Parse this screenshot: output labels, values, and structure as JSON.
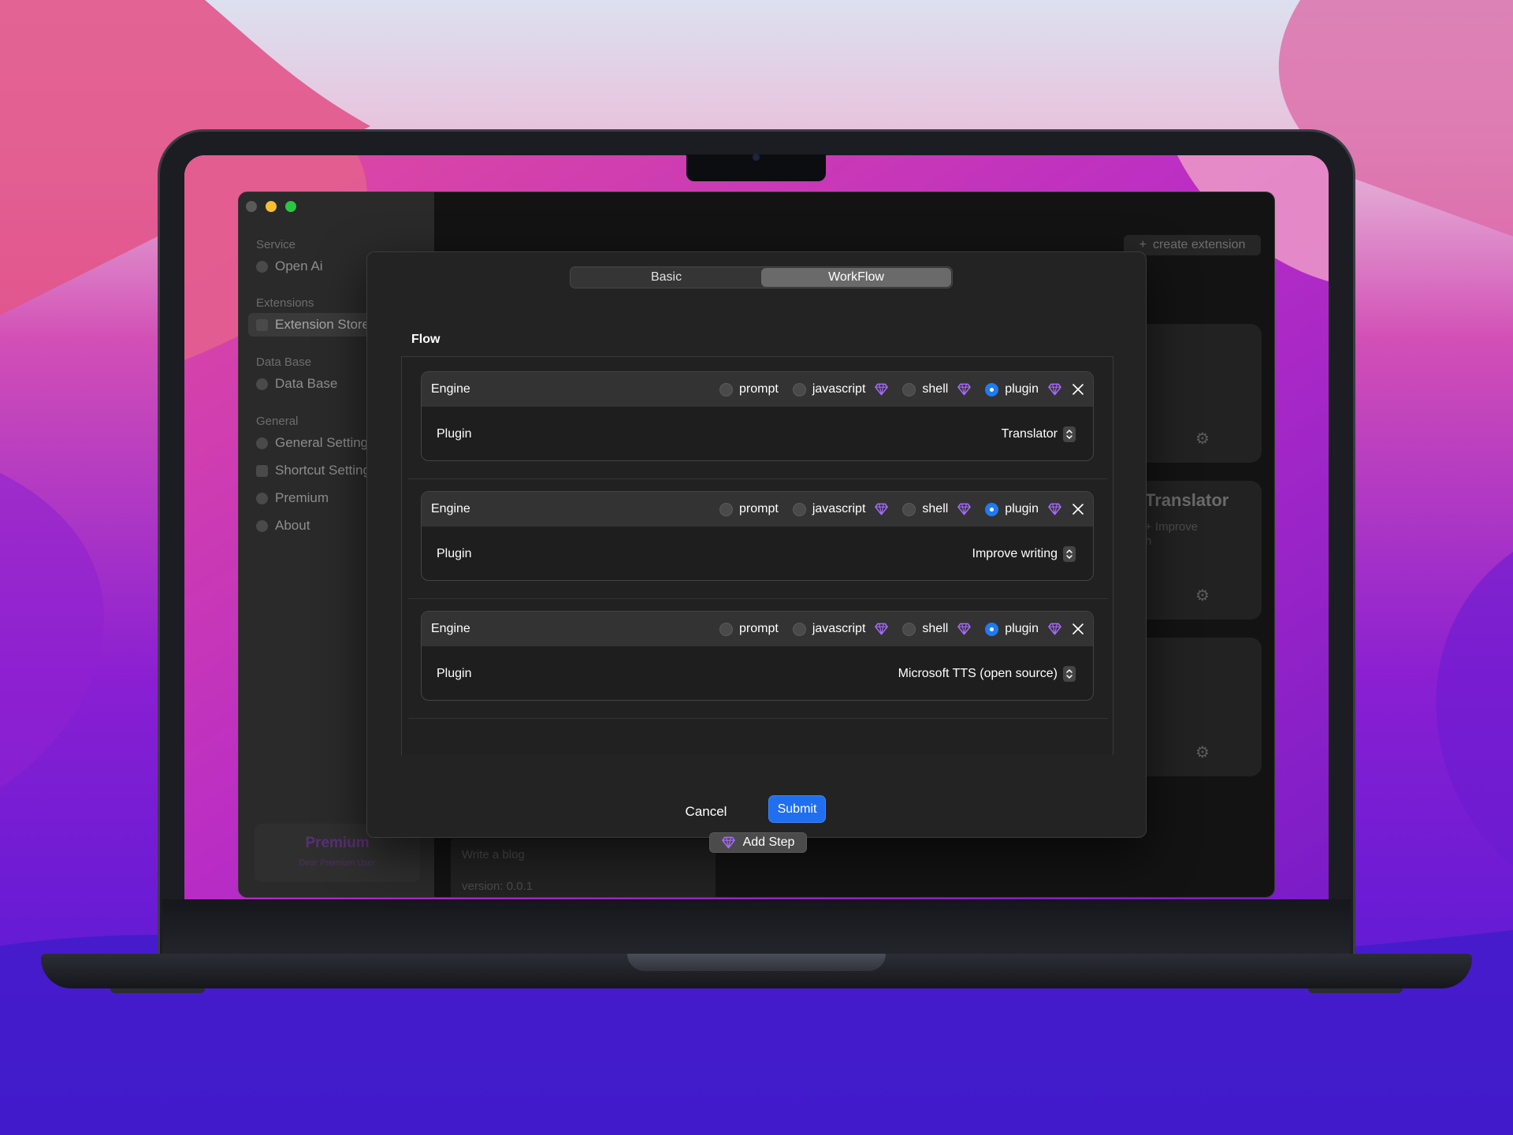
{
  "sidebar": {
    "sections": [
      {
        "title": "Service",
        "items": [
          {
            "label": "Open Ai"
          }
        ]
      },
      {
        "title": "Extensions",
        "items": [
          {
            "label": "Extension Store"
          }
        ]
      },
      {
        "title": "Data Base",
        "items": [
          {
            "label": "Data Base"
          }
        ]
      },
      {
        "title": "General",
        "items": [
          {
            "label": "General Settings"
          },
          {
            "label": "Shortcut Settings"
          },
          {
            "label": "Premium"
          },
          {
            "label": "About"
          }
        ]
      }
    ],
    "premium_card": {
      "title": "Premium",
      "subtitle": "Dear Premium User"
    }
  },
  "main": {
    "create_extension_label": "create extension",
    "bg_card_title": "Translator",
    "bg_card_sub": "+ Improve",
    "bg_card_sub2": "h",
    "bg_card_bottom_text": "Write a blog",
    "bg_card_version": "version: 0.0.1"
  },
  "modal": {
    "tabs": [
      {
        "label": "Basic",
        "active": false
      },
      {
        "label": "WorkFlow",
        "active": true
      }
    ],
    "flow_label": "Flow",
    "engine_label": "Engine",
    "engine_options": [
      "prompt",
      "javascript",
      "shell",
      "plugin"
    ],
    "premium_options": [
      "javascript",
      "shell",
      "plugin"
    ],
    "plugin_label": "Plugin",
    "steps": [
      {
        "engine": "plugin",
        "plugin": "Translator"
      },
      {
        "engine": "plugin",
        "plugin": "Improve writing"
      },
      {
        "engine": "plugin",
        "plugin": "Microsoft TTS (open source)"
      }
    ],
    "add_step_label": "Add Step",
    "cancel_label": "Cancel",
    "submit_label": "Submit"
  },
  "colors": {
    "accent": "#1f6ff0",
    "premium_gem": "#a86bff",
    "modal_bg": "#232323"
  },
  "icons": [
    "gem-icon",
    "close-icon",
    "stepper-icon",
    "plus-icon",
    "gear-icon"
  ]
}
